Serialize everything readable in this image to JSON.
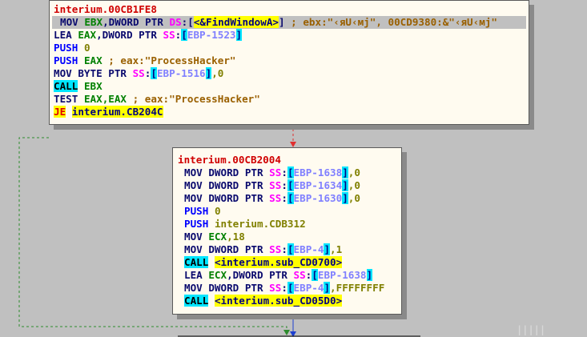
{
  "block_top": {
    "address": "interium.00CB1FE8",
    "lines": [
      {
        "mn": "MOV",
        "op1": "EBX",
        "sep1": ",DWORD PTR ",
        "seg": "DS",
        "open": ":[",
        "target": "<&FindWindowA>",
        "close": "]",
        "comment": " ; ebx:\"‹яU‹мј\", 00CD9380:&\"‹яU‹мј\""
      },
      {
        "mn": "LEA",
        "op1": "EAX",
        "sep1": ",DWORD PTR ",
        "seg": "SS",
        "open": ":",
        "br_open": "[",
        "mem": "EBP-1523",
        "br_close": "]"
      },
      {
        "mn": "PUSH",
        "val": "0"
      },
      {
        "mn": "PUSH",
        "op1": "EAX",
        "comment": " ; eax:\"ProcessHacker\""
      },
      {
        "mn": "MOV",
        "pre": "BYTE PTR ",
        "seg": "SS",
        "open": ":",
        "br_open": "[",
        "mem": "EBP-1516",
        "br_close": "]",
        "tail": ",0"
      },
      {
        "mn": "CALL",
        "op1": "EBX"
      },
      {
        "mn": "TEST",
        "op1": "EAX",
        "op2": ",EAX",
        "comment": " ; eax:\"ProcessHacker\""
      },
      {
        "mn": "JE",
        "target": "interium.CB204C"
      }
    ]
  },
  "block_bottom": {
    "address": "interium.00CB2004",
    "lines": [
      {
        "mn": "MOV",
        "pre": "DWORD PTR ",
        "seg": "SS",
        "open": ":",
        "br_open": "[",
        "mem": "EBP-1638",
        "br_close": "]",
        "tail": ",0"
      },
      {
        "mn": "MOV",
        "pre": "DWORD PTR ",
        "seg": "SS",
        "open": ":",
        "br_open": "[",
        "mem": "EBP-1634",
        "br_close": "]",
        "tail": ",0"
      },
      {
        "mn": "MOV",
        "pre": "DWORD PTR ",
        "seg": "SS",
        "open": ":",
        "br_open": "[",
        "mem": "EBP-1630",
        "br_close": "]",
        "tail": ",0"
      },
      {
        "mn": "PUSH",
        "val": "0"
      },
      {
        "mn": "PUSH",
        "val": "interium.CDB312"
      },
      {
        "mn": "MOV",
        "op1": "ECX",
        "tail": ",18"
      },
      {
        "mn": "MOV",
        "pre": "DWORD PTR ",
        "seg": "SS",
        "open": ":",
        "br_open": "[",
        "mem": "EBP-4",
        "br_close": "]",
        "tail": ",1"
      },
      {
        "mn": "CALL",
        "target": "<interium.sub_CD0700>"
      },
      {
        "mn": "LEA",
        "op1": "ECX",
        "sep1": ",DWORD PTR ",
        "seg": "SS",
        "open": ":",
        "br_open": "[",
        "mem": "EBP-1638",
        "br_close": "]"
      },
      {
        "mn": "MOV",
        "pre": "DWORD PTR ",
        "seg": "SS",
        "open": ":",
        "br_open": "[",
        "mem": "EBP-4",
        "br_close": "]",
        "tail": ",FFFFFFFF"
      },
      {
        "mn": "CALL",
        "target": "<interium.sub_CD05D0>"
      }
    ]
  },
  "colors": {
    "background": "#c0c0c0",
    "block_bg": "#fffbf0",
    "address": "#d00000",
    "edge_jump": "#2e8b2e",
    "edge_fall": "#e03030",
    "edge_next": "#1e40d0"
  },
  "watermark_text": "|||||"
}
